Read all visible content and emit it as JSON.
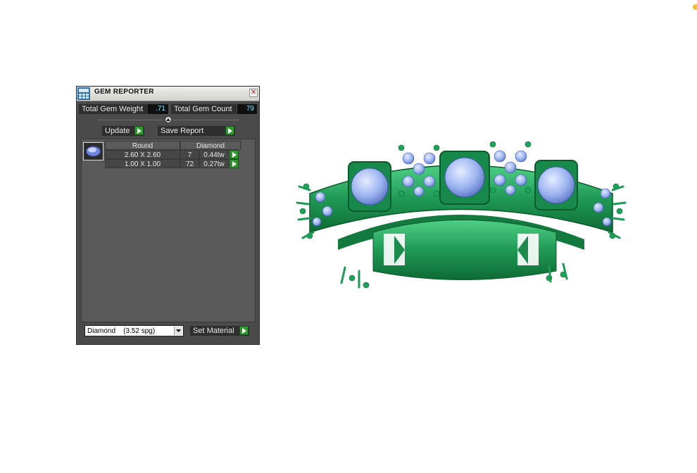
{
  "panel": {
    "title": "GEM REPORTER",
    "total_weight_label": "Total Gem Weight",
    "total_weight_value": ".71",
    "total_count_label": "Total Gem Count",
    "total_count_value": "79",
    "update_label": "Update",
    "save_report_label": "Save Report",
    "table": {
      "headers": [
        "Round",
        "Diamond"
      ],
      "rows": [
        {
          "size": "2.60 X 2.60",
          "count": "7",
          "weight": "0.44tw"
        },
        {
          "size": "1.00 X 1.00",
          "count": "72",
          "weight": "0.27tw"
        }
      ]
    },
    "material_select": "Diamond    (3.52 spg)",
    "set_material_label": "Set Material"
  },
  "icons": {
    "logo": "gem-reporter-logo-icon",
    "close": "close-icon",
    "collapse": "collapse-up-icon",
    "arrow": "green-play-arrow-icon",
    "gem": "round-gem-icon",
    "dropdown": "chevron-down-icon"
  },
  "colors": {
    "panel_bg": "#4a4a4a",
    "metal": "#2f9f5c",
    "gem": "#9db4f0",
    "value_text": "#7fe4ff",
    "arrow_green": "#2e9a2e"
  }
}
